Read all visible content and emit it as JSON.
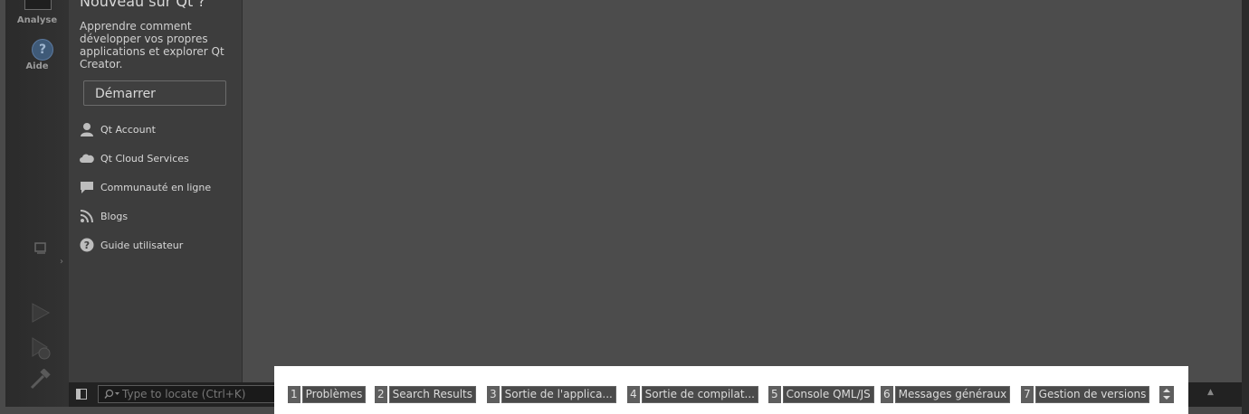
{
  "modebar": {
    "modes": [
      {
        "label": "Analyse",
        "icon": "analyze-icon"
      },
      {
        "label": "Aide",
        "icon": "help-icon"
      }
    ],
    "help_glyph": "?"
  },
  "welcome": {
    "title": "Nouveau sur Qt ?",
    "description": "Apprendre comment développer vos propres applications et explorer Qt Creator.",
    "start_button": "Démarrer",
    "links": [
      {
        "label": "Qt Account",
        "icon": "user-icon"
      },
      {
        "label": "Qt Cloud Services",
        "icon": "cloud-icon"
      },
      {
        "label": "Communauté en ligne",
        "icon": "chat-icon"
      },
      {
        "label": "Blogs",
        "icon": "rss-icon"
      },
      {
        "label": "Guide utilisateur",
        "icon": "question-icon"
      }
    ]
  },
  "statusbar": {
    "locator_placeholder": "Type to locate (Ctrl+K)",
    "output_panes": [
      {
        "num": "1",
        "label": "Problèmes"
      },
      {
        "num": "2",
        "label": "Search Results"
      },
      {
        "num": "3",
        "label": "Sortie de l'applica..."
      },
      {
        "num": "4",
        "label": "Sortie de compilat..."
      },
      {
        "num": "5",
        "label": "Console QML/JS"
      },
      {
        "num": "6",
        "label": "Messages généraux"
      },
      {
        "num": "7",
        "label": "Gestion de versions"
      }
    ]
  },
  "colors": {
    "editor_bg": "#4a4a4a",
    "panel_bg": "#3d3d3d",
    "modebar_bg": "#2b2b2b",
    "help_icon": "#3f5a78"
  }
}
